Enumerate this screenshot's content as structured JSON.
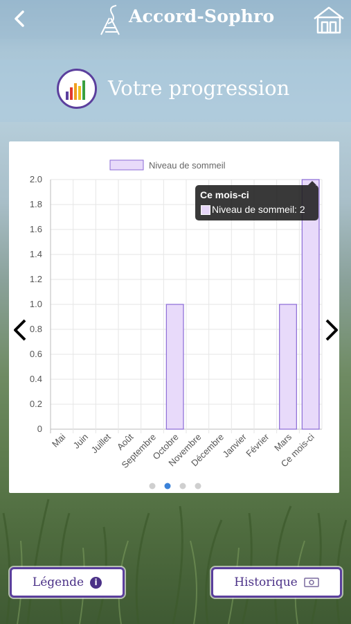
{
  "header": {
    "app_title": "Accord-Sophro",
    "back_icon": "chevron-left-icon",
    "home_icon": "home-icon",
    "logo_icon": "sophro-logo"
  },
  "page": {
    "title": "Votre progression",
    "title_icon": "bar-chart-icon"
  },
  "chart": {
    "legend_label": "Niveau de sommeil",
    "tooltip_title": "Ce mois-ci",
    "tooltip_text": "Niveau de sommeil: 2",
    "active_page": 2,
    "page_count": 4
  },
  "chart_data": {
    "type": "bar",
    "categories": [
      "Mai",
      "Juin",
      "Juillet",
      "Août",
      "Septembre",
      "Octobre",
      "Novembre",
      "Décembre",
      "Janvier",
      "Février",
      "Mars",
      "Ce mois-ci"
    ],
    "series": [
      {
        "name": "Niveau de sommeil",
        "values": [
          0,
          0,
          0,
          0,
          0,
          1,
          0,
          0,
          0,
          0,
          1,
          2
        ]
      }
    ],
    "ylim": [
      0,
      2
    ],
    "yticks": [
      "0",
      "0.2",
      "0.4",
      "0.6",
      "0.8",
      "1.0",
      "1.2",
      "1.4",
      "1.6",
      "1.8",
      "2.0"
    ],
    "grid": true,
    "legend": "top",
    "bar_fill": "#e8dafa",
    "bar_stroke": "#8a6ad6"
  },
  "buttons": {
    "legend_label": "Légende",
    "legend_icon": "info-icon",
    "history_label": "Historique",
    "history_icon": "money-icon"
  },
  "nav": {
    "prev_icon": "chevron-left-icon",
    "next_icon": "chevron-right-icon"
  }
}
